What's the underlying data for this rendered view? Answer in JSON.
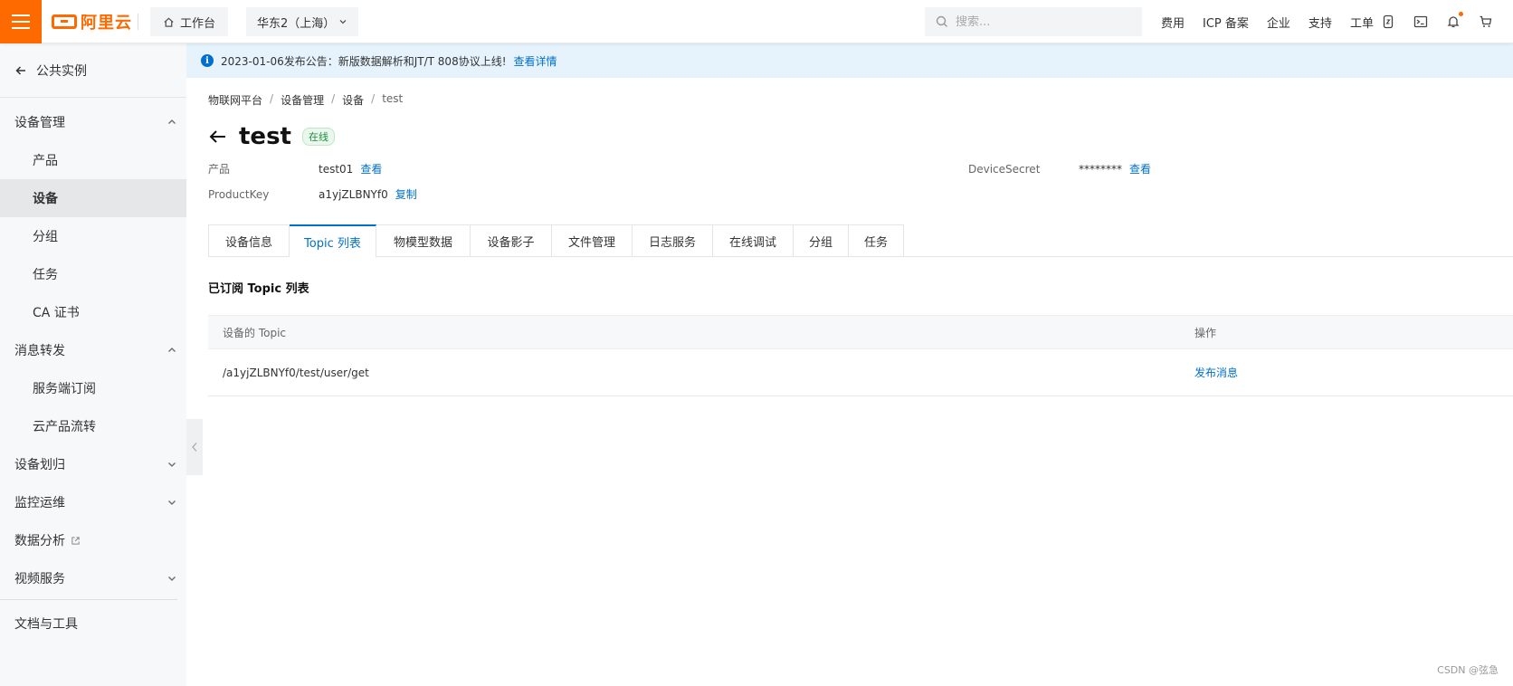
{
  "topbar": {
    "logo_text": "阿里云",
    "workbench_label": "工作台",
    "region_label": "华东2（上海）",
    "search_placeholder": "搜索...",
    "links": [
      "费用",
      "ICP 备案",
      "企业",
      "支持",
      "工单"
    ],
    "icons": [
      "mobile-icon",
      "terminal-icon",
      "bell-icon",
      "cart-icon"
    ],
    "accent_color": "#ff6a00"
  },
  "sidebar": {
    "back_label": "公共实例",
    "groups": [
      {
        "label": "设备管理",
        "expanded": true,
        "items": [
          "产品",
          "设备",
          "分组",
          "任务",
          "CA 证书"
        ],
        "active_item": "设备"
      },
      {
        "label": "消息转发",
        "expanded": true,
        "items": [
          "服务端订阅",
          "云产品流转"
        ]
      },
      {
        "label": "设备划归",
        "expanded": false,
        "items": []
      },
      {
        "label": "监控运维",
        "expanded": false,
        "items": []
      },
      {
        "label": "数据分析",
        "external": true,
        "items": []
      },
      {
        "label": "视频服务",
        "expanded": false,
        "items": []
      }
    ],
    "footer_label": "文档与工具"
  },
  "notice": {
    "text": "2023-01-06发布公告：新版数据解析和JT/T 808协议上线!",
    "link": "查看详情"
  },
  "breadcrumb": [
    "物联网平台",
    "设备管理",
    "设备",
    "test"
  ],
  "device": {
    "name": "test",
    "status": "在线",
    "product_key_label": "产品",
    "product_value": "test01",
    "product_link": "查看",
    "productkey_label": "ProductKey",
    "productkey_value": "a1yjZLBNYf0",
    "productkey_link": "复制",
    "secret_label": "DeviceSecret",
    "secret_value": "********",
    "secret_link": "查看"
  },
  "tabs": [
    "设备信息",
    "Topic 列表",
    "物模型数据",
    "设备影子",
    "文件管理",
    "日志服务",
    "在线调试",
    "分组",
    "任务"
  ],
  "active_tab": "Topic 列表",
  "section_title": "已订阅 Topic 列表",
  "table": {
    "headers": [
      "设备的 Topic",
      "操作"
    ],
    "rows": [
      {
        "topic": "/a1yjZLBNYf0/test/user/get",
        "action": "发布消息"
      }
    ]
  },
  "watermark": "CSDN @弦急"
}
